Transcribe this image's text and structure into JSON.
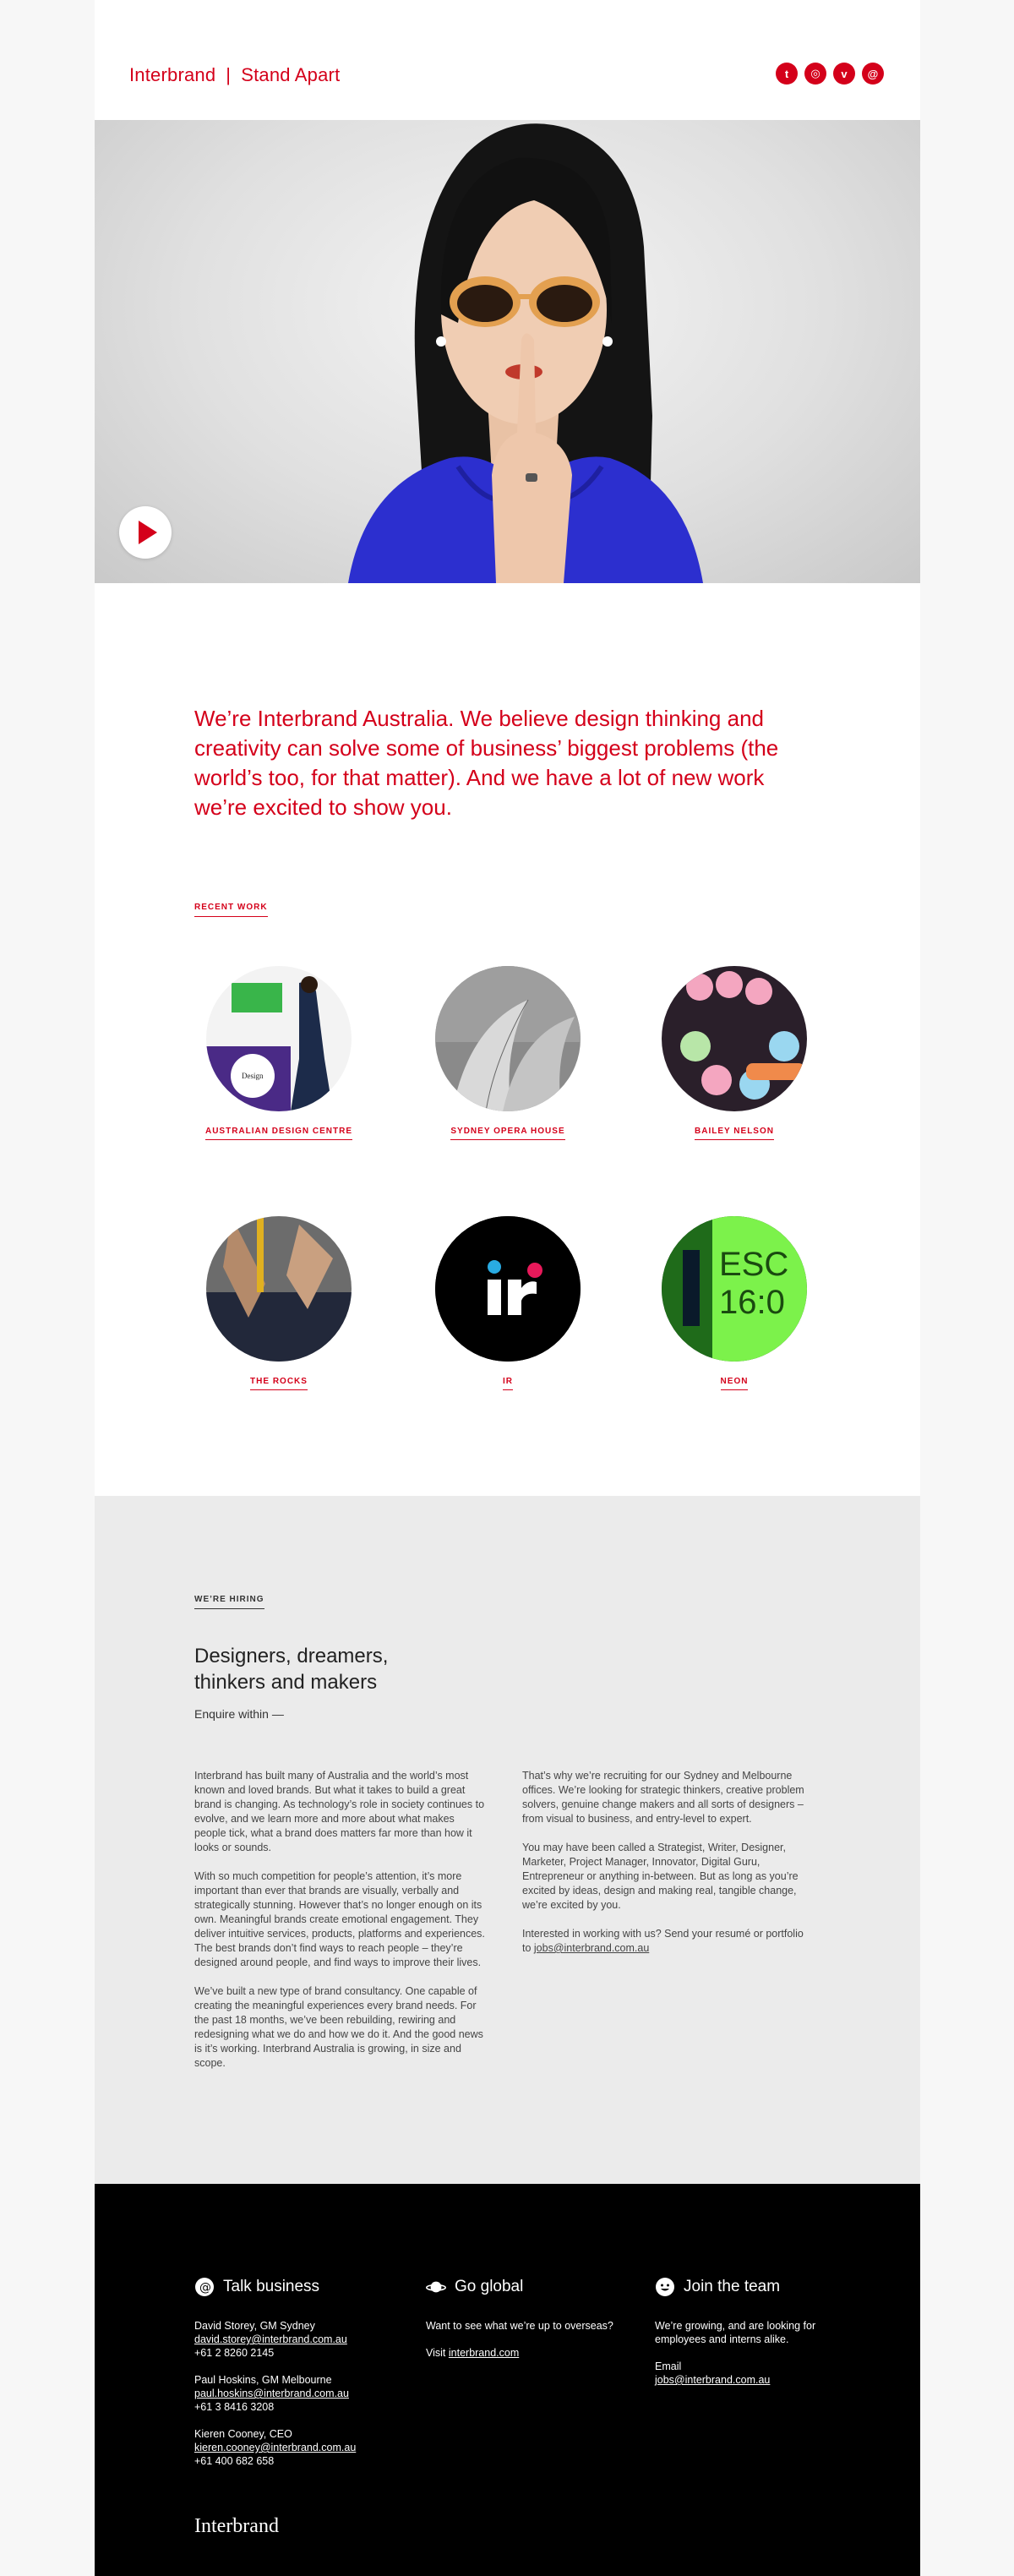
{
  "header": {
    "brand_name": "Interbrand",
    "separator": "|",
    "tagline": "Stand Apart",
    "social": [
      {
        "icon": "twitter-icon",
        "glyph": "t"
      },
      {
        "icon": "instagram-icon",
        "glyph": "◎"
      },
      {
        "icon": "vimeo-icon",
        "glyph": "v"
      },
      {
        "icon": "email-icon",
        "glyph": "@"
      }
    ]
  },
  "hero": {
    "play_icon": "play-icon"
  },
  "intro": {
    "text": "We’re Interbrand Australia. We believe design thinking and creativity can solve some of business’ biggest problems (the world’s too, for that matter). And we have a lot of new work we’re excited to show you."
  },
  "recent_work": {
    "label": "RECENT WORK",
    "items": [
      {
        "label": "AUSTRALIAN DESIGN CENTRE"
      },
      {
        "label": "SYDNEY OPERA HOUSE"
      },
      {
        "label": "BAILEY NELSON"
      },
      {
        "label": "THE ROCKS"
      },
      {
        "label": "IR"
      },
      {
        "label": "NEON"
      }
    ]
  },
  "hiring": {
    "label": "WE’RE HIRING",
    "title": "Designers, dreamers, thinkers and makers",
    "subtitle": "Enquire within —",
    "col1": [
      "Interbrand has built many of Australia and the world’s most known and loved brands. But what it takes to build a great brand is changing. As technology’s role in society continues to evolve, and we learn more and more about what makes people tick, what a brand does matters far more than how it looks or sounds.",
      "With so much competition for people’s attention, it’s more important than ever that brands are visually, verbally and strategically stunning. However that’s no longer enough on its own. Meaningful brands create emotional engagement. They deliver intuitive services, products, platforms and experiences. The best brands don’t find ways to reach people – they’re designed around people, and find ways to improve their lives.",
      "We’ve built a new type of brand consultancy. One capable of creating the meaningful experiences every brand needs. For the past 18 months, we’ve been rebuilding, rewiring and redesigning what we do and how we do it. And the good news is it’s working. Interbrand Australia is growing, in size and scope."
    ],
    "col2": [
      "That’s why we’re recruiting for our Sydney and Melbourne offices. We’re looking for strategic thinkers, creative problem solvers, genuine change makers and all sorts of designers – from visual to business, and entry-level to expert.",
      "You may have been called a Strategist, Writer, Designer, Marketer, Project Manager, Innovator, Digital Guru, Entrepreneur or anything in-between. But as long as you’re excited by ideas, design and making real, tangible change, we’re excited by you."
    ],
    "col2_last_prefix": "Interested in working with us? Send your resumé or portfolio to ",
    "col2_email": "jobs@interbrand.com.au"
  },
  "footer": {
    "talk": {
      "title": "Talk business",
      "contacts": [
        {
          "name": "David Storey, GM Sydney",
          "email": "david.storey@interbrand.com.au",
          "phone": "+61 2 8260 2145"
        },
        {
          "name": "Paul Hoskins, GM Melbourne",
          "email": "paul.hoskins@interbrand.com.au",
          "phone": "+61 3 8416 3208"
        },
        {
          "name": "Kieren Cooney, CEO",
          "email": "kieren.cooney@interbrand.com.au",
          "phone": "+61 400 682 658"
        }
      ]
    },
    "global": {
      "title": "Go global",
      "text": "Want to see what we’re up to overseas?",
      "visit_prefix": "Visit ",
      "visit_link": "interbrand.com"
    },
    "team": {
      "title": "Join the team",
      "text": "We’re growing, and are looking for employees and interns alike.",
      "email_label": "Email",
      "email": "jobs@interbrand.com.au"
    },
    "wordmark": "Interbrand"
  },
  "colors": {
    "accent": "#d4001a",
    "footer_bg": "#000000",
    "hiring_bg": "#ebebeb"
  }
}
